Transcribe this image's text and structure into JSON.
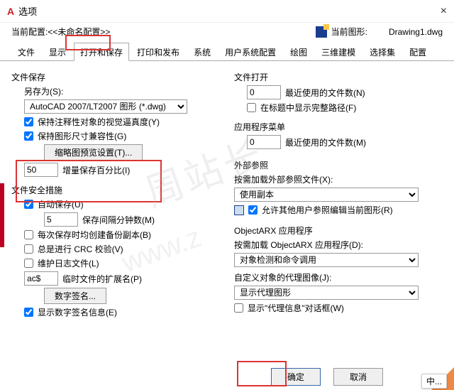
{
  "titlebar": {
    "app_icon": "A",
    "title": "选项"
  },
  "profile": {
    "label": "当前配置:",
    "value": "<<未命名配置>>",
    "drawing_label": "当前图形:",
    "drawing_value": "Drawing1.dwg"
  },
  "tabs": [
    "文件",
    "显示",
    "打开和保存",
    "打印和发布",
    "系统",
    "用户系统配置",
    "绘图",
    "三维建模",
    "选择集",
    "配置"
  ],
  "active_tab": "打开和保存",
  "left": {
    "file_save": {
      "legend": "文件保存",
      "save_as_label": "另存为(S):",
      "save_as_value": "AutoCAD 2007/LT2007 图形 (*.dwg)",
      "ck_annotative": "保持注释性对象的视觉逼真度(Y)",
      "ck_drawing_size": "保持图形尺寸兼容性(G)",
      "btn_thumb": "缩略图预览设置(T)...",
      "inc_val": "50",
      "inc_label": "增量保存百分比(I)"
    },
    "safety": {
      "legend": "文件安全措施",
      "ck_autosave": "自动保存(U)",
      "autosave_val": "5",
      "autosave_label": "保存间隔分钟数(M)",
      "ck_backup": "每次保存时均创建备份副本(B)",
      "ck_crc": "总是进行 CRC 校验(V)",
      "ck_log": "维护日志文件(L)",
      "ext_val": "ac$",
      "ext_label": "临时文件的扩展名(P)",
      "btn_sig": "数字签名...",
      "ck_show_sig": "显示数字签名信息(E)"
    }
  },
  "right": {
    "file_open": {
      "legend": "文件打开",
      "recent_val": "0",
      "recent_label": "最近使用的文件数(N)",
      "ck_fullpath": "在标题中显示完整路径(F)"
    },
    "app_menu": {
      "legend": "应用程序菜单",
      "recent_val": "0",
      "recent_label": "最近使用的文件数(M)"
    },
    "xref": {
      "legend": "外部参照",
      "load_label": "按需加载外部参照文件(X):",
      "load_value": "使用副本",
      "ck_allow_edit": "允许其他用户参照编辑当前图形(R)"
    },
    "arx": {
      "legend": "ObjectARX 应用程序",
      "load_label": "按需加载 ObjectARX 应用程序(D):",
      "load_value": "对象检测和命令调用",
      "proxy_label": "自定义对象的代理图像(J):",
      "proxy_value": "显示代理图形",
      "ck_proxy_dlg": "显示\"代理信息\"对话框(W)"
    }
  },
  "footer": {
    "ok": "确定",
    "cancel": "取消"
  },
  "badge": "中..."
}
